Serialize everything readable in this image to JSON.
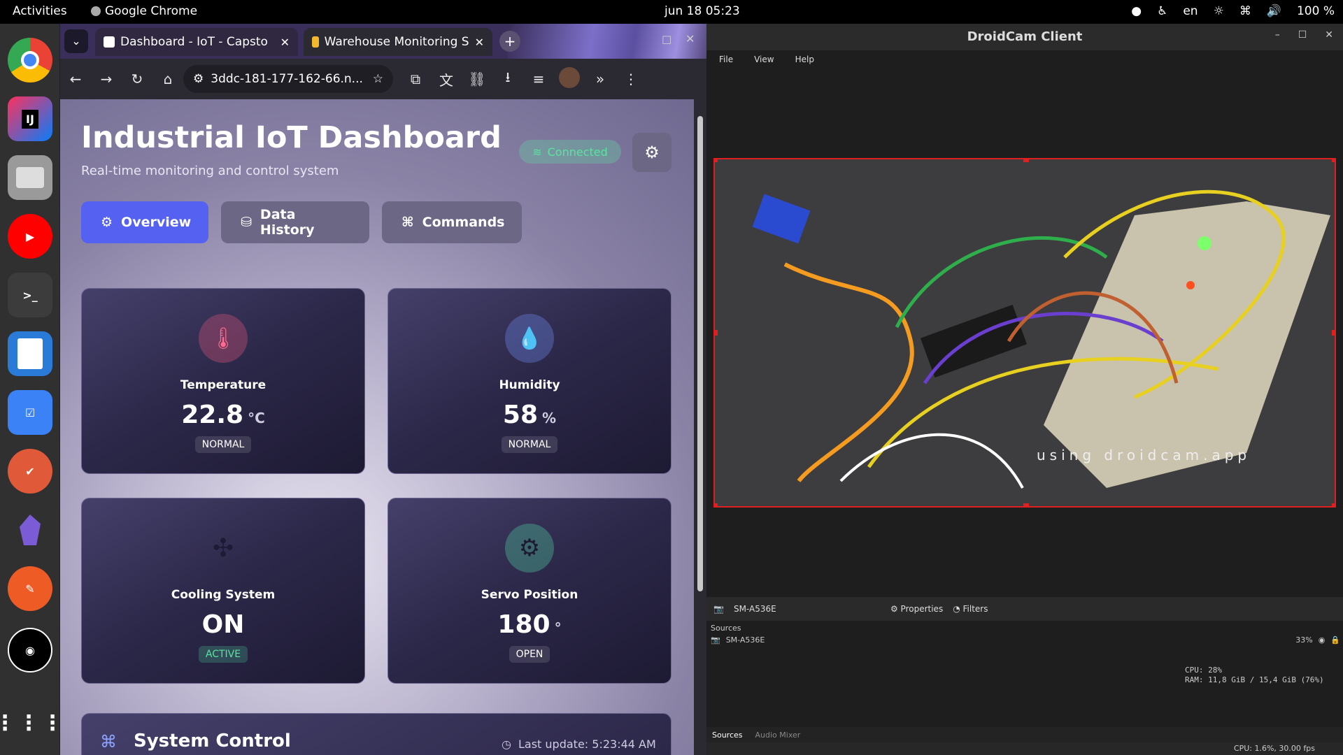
{
  "topbar": {
    "activities": "Activities",
    "app_name": "Google Chrome",
    "clock": "jun 18  05:23",
    "lang": "en",
    "battery": "100 %"
  },
  "dock": {
    "items": [
      "chrome",
      "intellij",
      "files",
      "youtube-music",
      "terminal",
      "writer",
      "tasks",
      "todoist",
      "obsidian",
      "postman",
      "webcam",
      "app-grid"
    ]
  },
  "chrome": {
    "tabs": [
      {
        "title": "Dashboard - IoT - Capsto",
        "active": false
      },
      {
        "title": "Warehouse Monitoring S",
        "active": true
      }
    ],
    "url": "3ddc-181-177-162-66.n..."
  },
  "dashboard": {
    "title": "Industrial IoT Dashboard",
    "subtitle": "Real-time monitoring and control system",
    "connection": "Connected",
    "nav": [
      {
        "label": "Overview",
        "active": true
      },
      {
        "label": "Data History",
        "active": false
      },
      {
        "label": "Commands",
        "active": false
      }
    ],
    "cards": [
      {
        "label": "Temperature",
        "value": "22.8",
        "unit": "°C",
        "status": "NORMAL",
        "accent": "#e0557a"
      },
      {
        "label": "Humidity",
        "value": "58",
        "unit": "%",
        "status": "NORMAL",
        "accent": "#6f8bf0"
      },
      {
        "label": "Cooling System",
        "value": "ON",
        "unit": "",
        "status": "ACTIVE",
        "accent": "#2a2a3a"
      },
      {
        "label": "Servo Position",
        "value": "180",
        "unit": "°",
        "status": "OPEN",
        "accent": "#4fd0a0"
      }
    ],
    "system_control": {
      "title": "System Control",
      "last_update": "Last update: 5:23:44 AM"
    }
  },
  "droidcam": {
    "title": "DroidCam Client",
    "menu": [
      "File",
      "View",
      "Help"
    ],
    "watermark": "using droidcam.app",
    "device": "SM-A536E",
    "properties": "Properties",
    "filters": "Filters",
    "sources_label": "Sources",
    "source_item": "SM-A536E",
    "volume": "33%",
    "cpu": "CPU: 28%",
    "ram": "RAM: 11,8 GiB / 15,4 GiB (76%)",
    "tabs": [
      "Sources",
      "Audio Mixer"
    ],
    "status": "CPU: 1.6%, 30.00 fps"
  }
}
